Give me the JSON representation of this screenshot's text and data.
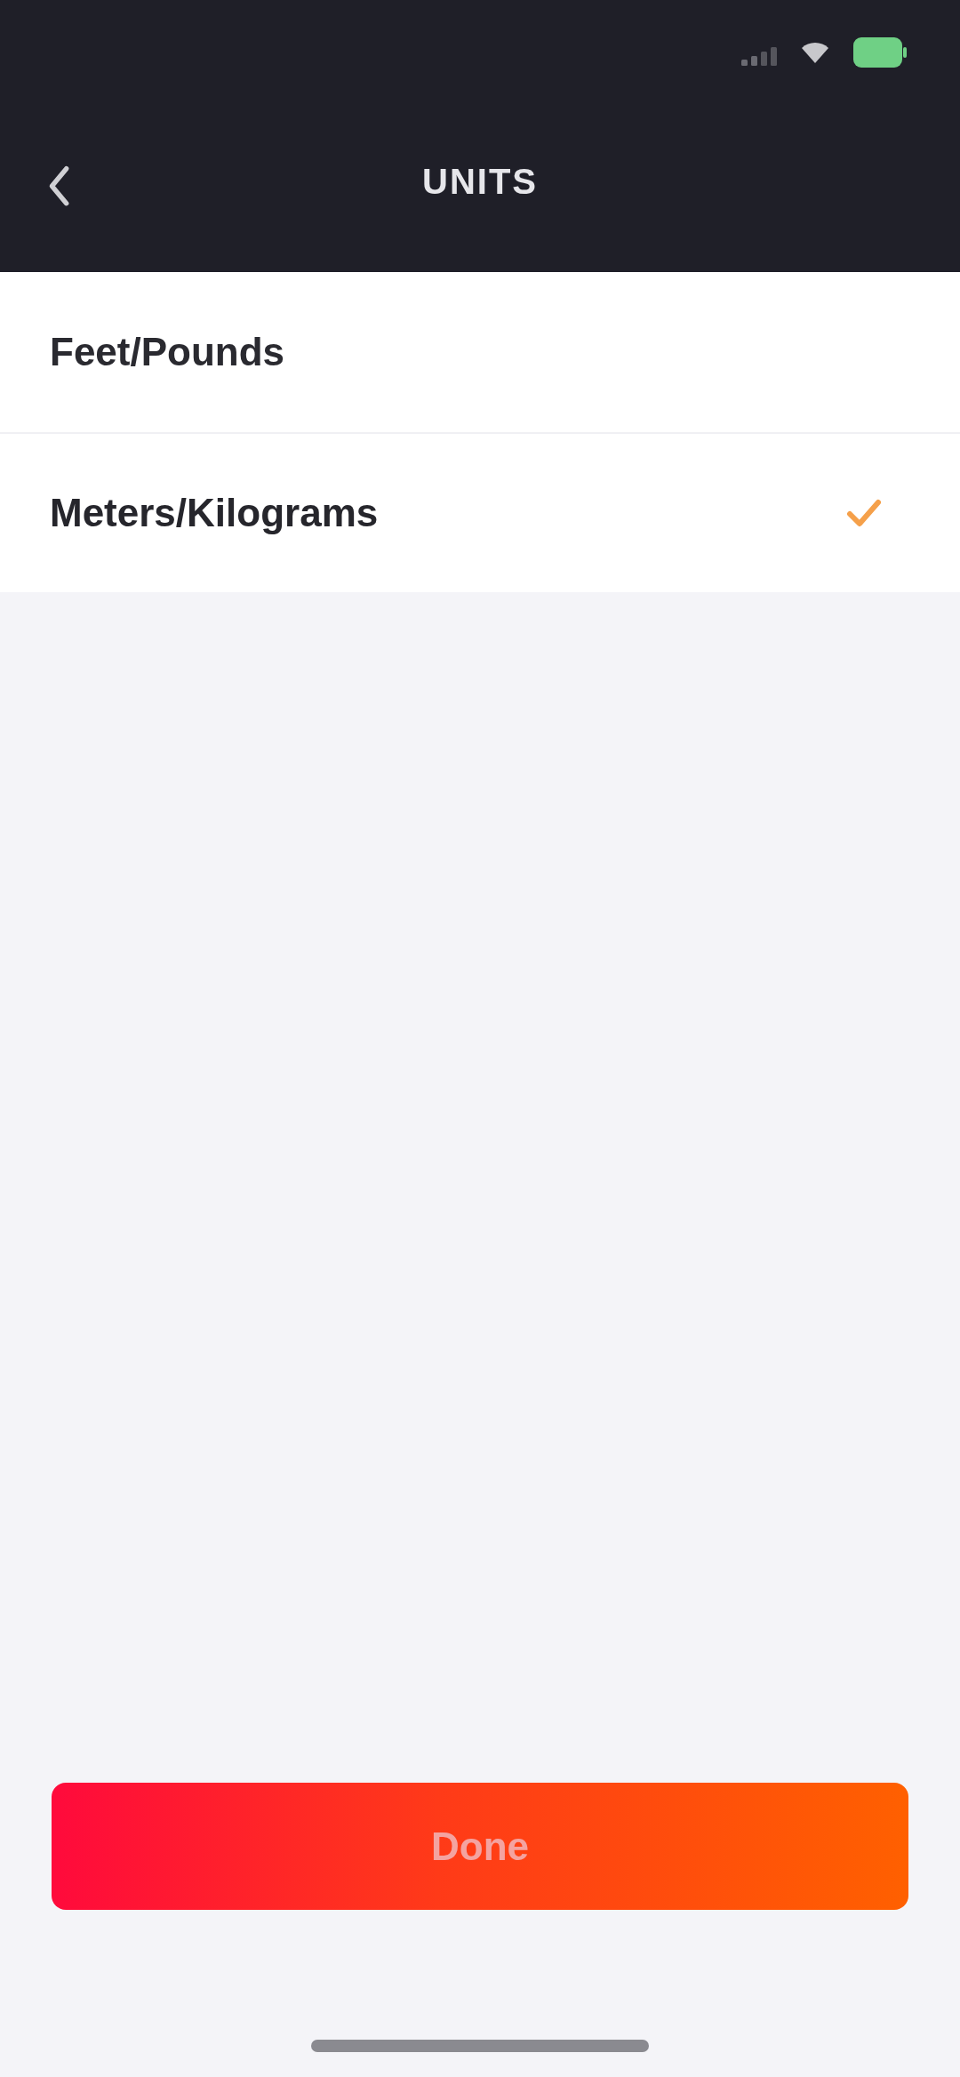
{
  "header": {
    "title": "UNITS"
  },
  "options": [
    {
      "label": "Feet/Pounds",
      "selected": false
    },
    {
      "label": "Meters/Kilograms",
      "selected": true
    }
  ],
  "done_button": {
    "label": "Done"
  }
}
